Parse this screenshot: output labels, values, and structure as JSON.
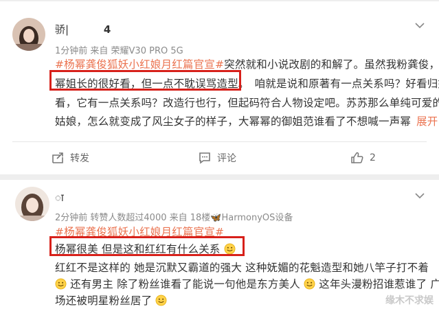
{
  "post1": {
    "username": "骄|",
    "username_suffix": "4",
    "meta": "1分钟前  来自 荣耀V30 PRO 5G",
    "lines": [
      {
        "tag": "#杨幂龚俊狐妖小红娘月红篇官宣#",
        "text": "突然就和小说改剧的和解了。虽然我粉龚俊，"
      },
      {
        "text": "幂姐长的很好看，但一点不耽误骂造型。",
        "rest": "咱就是说和原著有一点关系吗？好看归好"
      },
      {
        "text": "看，它有一点关系吗？改造行也行，但起码符合人物设定吧。苏苏那么单纯可爱的"
      },
      {
        "text": "姑娘，怎么就变成了风尘女子的样子，大幂幂的御姐范谁看了不想喊一声幂",
        "more": "展开"
      }
    ],
    "actions": [
      {
        "icon": "share-icon",
        "label": "转发"
      },
      {
        "icon": "comment-icon",
        "label": "评论"
      },
      {
        "icon": "like-icon",
        "label": "2"
      }
    ]
  },
  "post2": {
    "username": "ा",
    "meta": "2分钟前  转赞人数超过4000  来自 18楼🦋HarmonyOS设备",
    "lines": [
      {
        "tag": "#杨幂龚俊狐妖小红娘月红篇官宣#"
      },
      {
        "text": "杨幂很美 但是这和红红有什么关系"
      },
      {
        "text": "红红不是这样的 她是沉默又霸道的强大 这种妩媚的花魁造型和她八竿子打不着"
      },
      {
        "text_a": "还有男主 除了粉丝谁看了能说一句他是东方美人",
        "text_b": "这年头漫粉招谁惹谁了 广"
      },
      {
        "text": "场还被明星粉丝居了"
      }
    ]
  },
  "watermark": "缘木不求娱",
  "colors": {
    "accent": "#eb7350",
    "highlight_box": "#d7201a"
  }
}
